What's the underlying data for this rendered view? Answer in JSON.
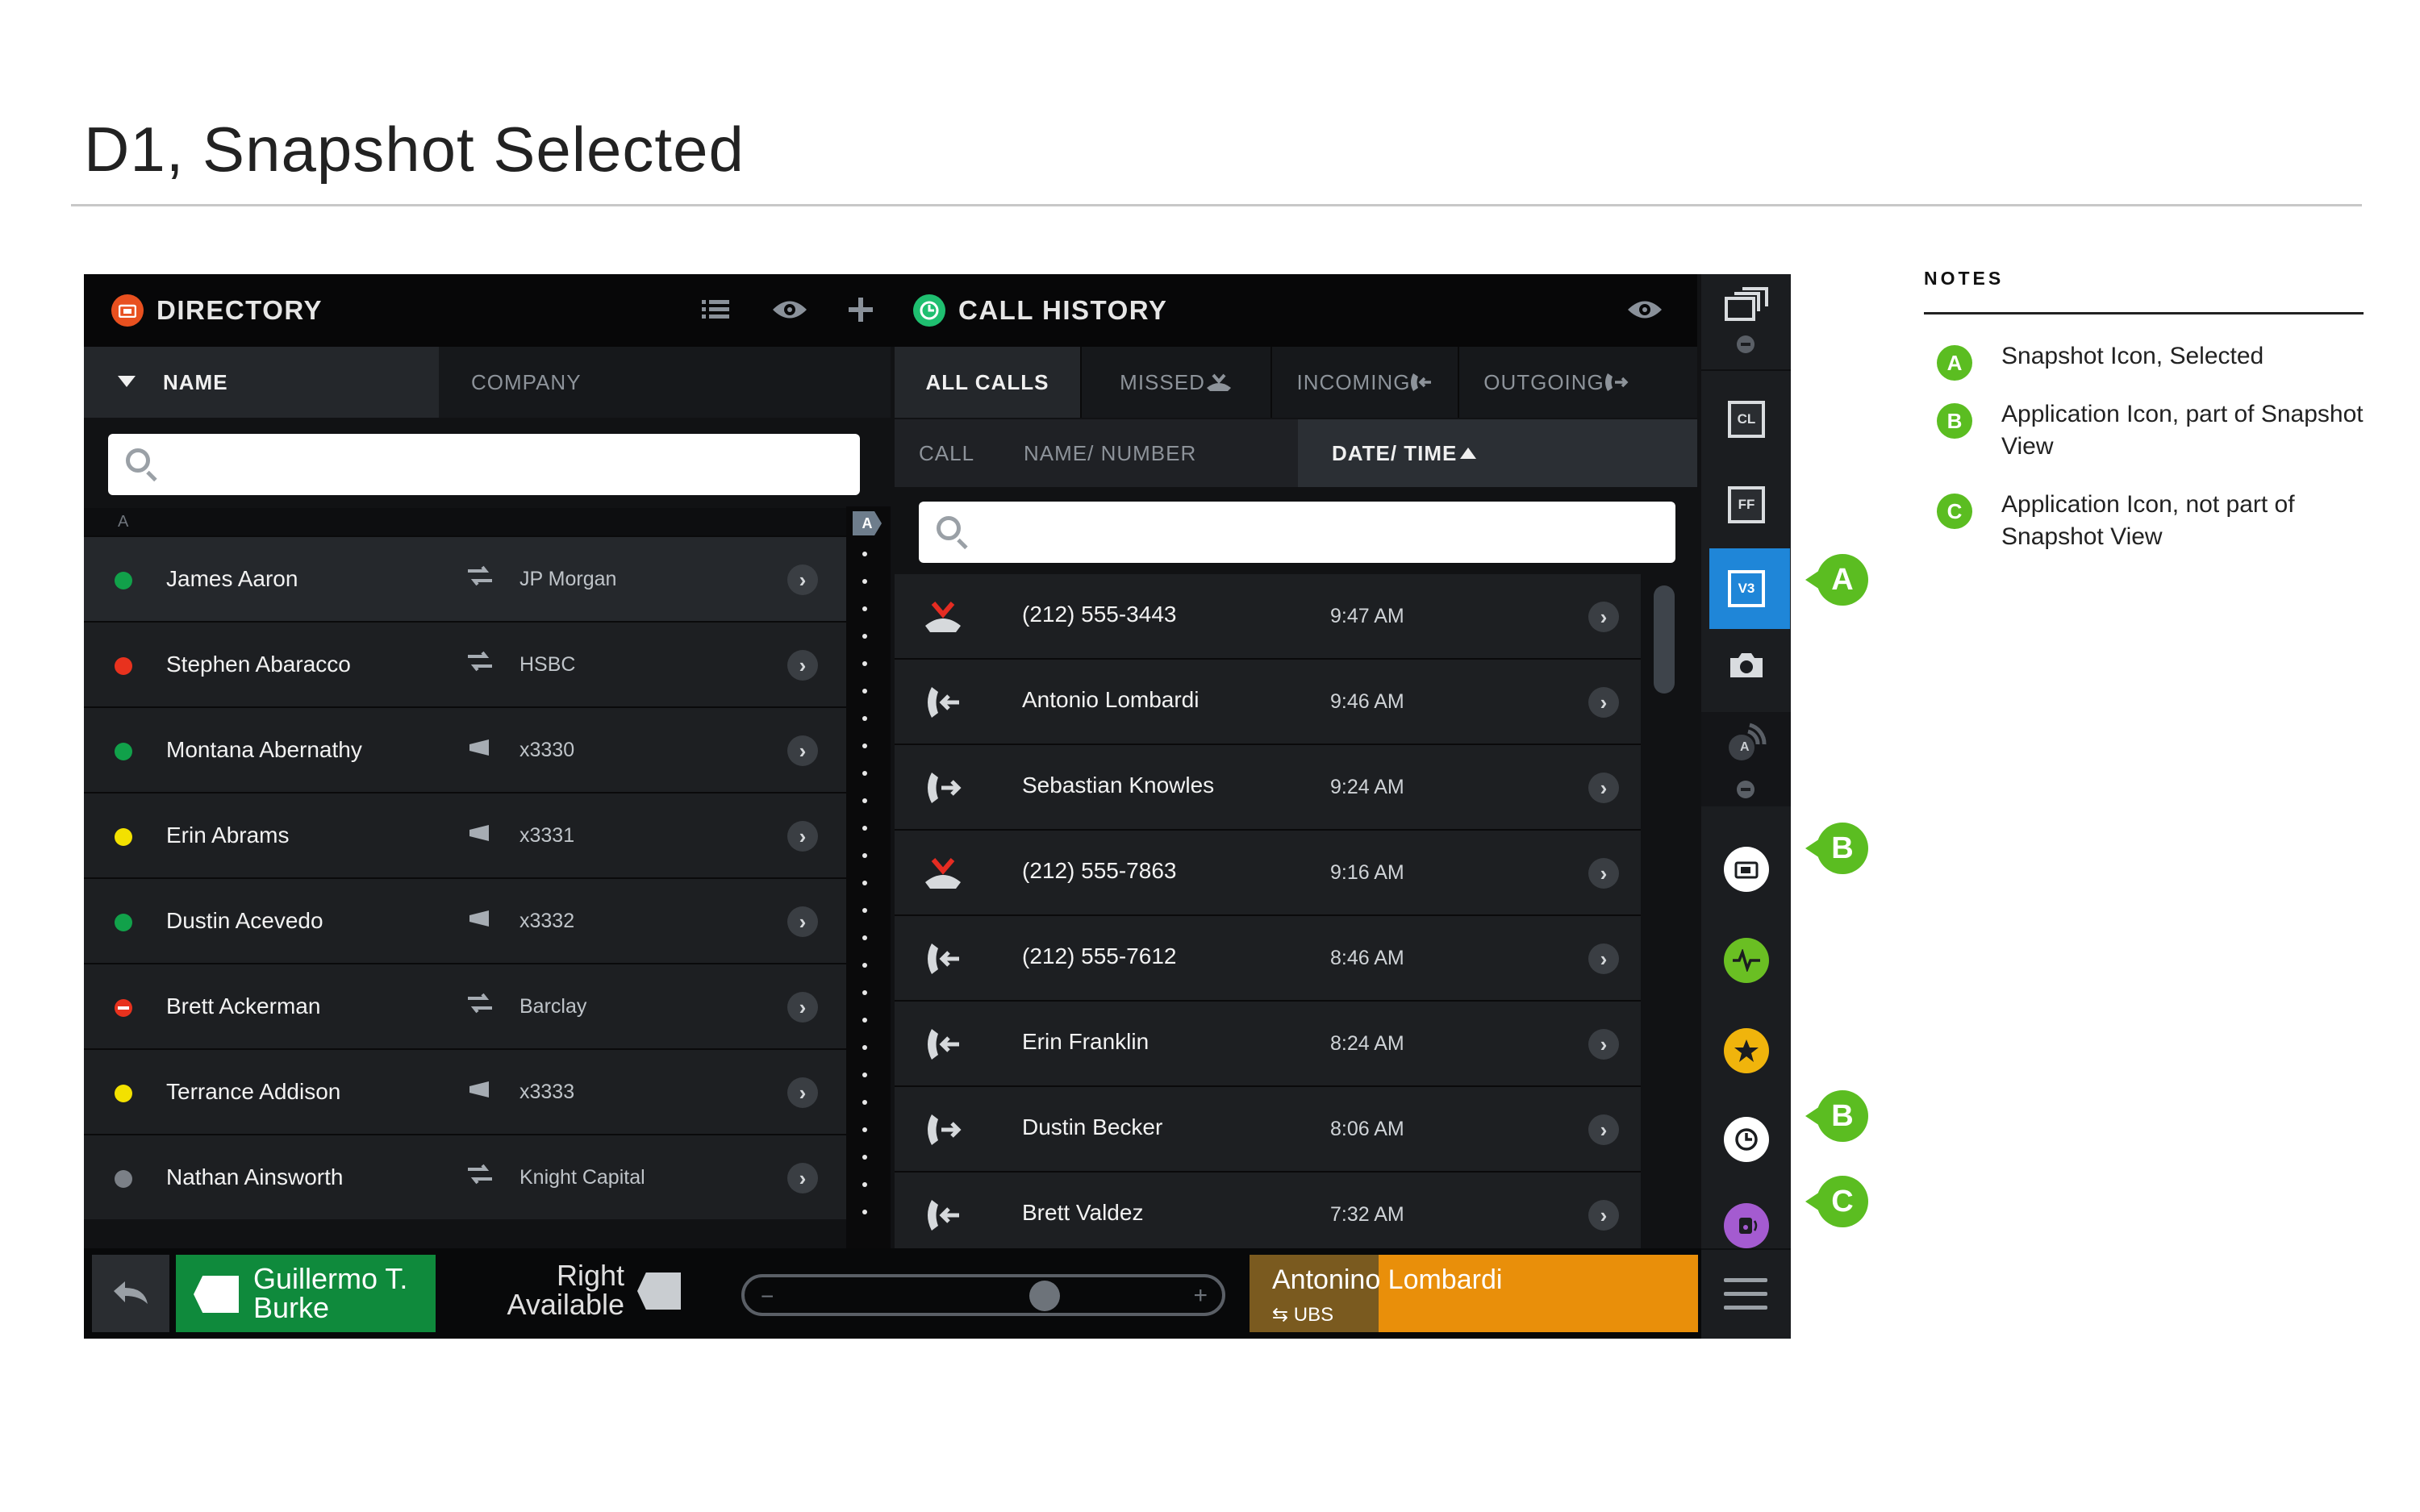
{
  "page": {
    "title": "D1, Snapshot Selected"
  },
  "notes": {
    "heading": "NOTES",
    "items": [
      {
        "badge": "A",
        "text": "Snapshot Icon, Selected"
      },
      {
        "badge": "B",
        "text": "Application Icon, part of Snapshot View"
      },
      {
        "badge": "C",
        "text": "Application Icon, not part of Snapshot View"
      }
    ]
  },
  "markers": {
    "a": "A",
    "b1": "B",
    "b2": "B",
    "c": "C"
  },
  "directory": {
    "title": "DIRECTORY",
    "tabs": {
      "name": "NAME",
      "company": "COMPANY"
    },
    "search": {
      "placeholder": ""
    },
    "section_letter": "A",
    "alpha_tag": "A",
    "rows": [
      {
        "name": "James Aaron",
        "status": "green",
        "type": "trade-icon",
        "company": "JP Morgan"
      },
      {
        "name": "Stephen Abaracco",
        "status": "red",
        "type": "trade-icon",
        "company": "HSBC"
      },
      {
        "name": "Montana Abernathy",
        "status": "green",
        "type": "extension-icon",
        "company": "x3330"
      },
      {
        "name": "Erin Abrams",
        "status": "yellow",
        "type": "extension-icon",
        "company": "x3331"
      },
      {
        "name": "Dustin Acevedo",
        "status": "green",
        "type": "extension-icon",
        "company": "x3332"
      },
      {
        "name": "Brett Ackerman",
        "status": "dnd",
        "type": "trade-icon",
        "company": "Barclay"
      },
      {
        "name": "Terrance Addison",
        "status": "yellow",
        "type": "extension-icon",
        "company": "x3333"
      },
      {
        "name": "Nathan Ainsworth",
        "status": "gray",
        "type": "trade-icon",
        "company": "Knight Capital"
      }
    ]
  },
  "call_history": {
    "title": "CALL HISTORY",
    "tabs": {
      "all": "ALL CALLS",
      "missed": "MISSED",
      "incoming": "INCOMING",
      "outgoing": "OUTGOING"
    },
    "columns": {
      "call": "CALL",
      "name_number": "NAME/ NUMBER",
      "date_time": "DATE/ TIME"
    },
    "search": {
      "placeholder": ""
    },
    "rows": [
      {
        "type": "missed",
        "party": "(212) 555-3443",
        "time": "9:47 AM"
      },
      {
        "type": "incoming",
        "party": "Antonio Lombardi",
        "time": "9:46 AM"
      },
      {
        "type": "outgoing",
        "party": "Sebastian Knowles",
        "time": "9:24 AM"
      },
      {
        "type": "missed",
        "party": "(212) 555-7863",
        "time": "9:16 AM"
      },
      {
        "type": "incoming",
        "party": "(212) 555-7612",
        "time": "8:46 AM"
      },
      {
        "type": "incoming",
        "party": "Erin Franklin",
        "time": "8:24 AM"
      },
      {
        "type": "outgoing",
        "party": "Dustin Becker",
        "time": "8:06 AM"
      },
      {
        "type": "incoming",
        "party": "Brett Valdez",
        "time": "7:32 AM"
      }
    ]
  },
  "rail": {
    "cl": "CL",
    "ff": "FF",
    "v3": "V3",
    "presence_letter": "A"
  },
  "bottom_bar": {
    "active_call_line1": "Guillermo T.",
    "active_call_line2": "Burke",
    "right_line1": "Right",
    "right_line2": "Available",
    "slider_minus": "−",
    "slider_plus": "+",
    "other_call_name": "Antonino Lombardi",
    "other_call_firm": "UBS",
    "slider_level": 0.64
  },
  "colors": {
    "status_green": "#11a14a",
    "status_red": "#e8321e",
    "status_yellow": "#f3e100",
    "status_gray": "#7b8087",
    "missed_red": "#e52c22",
    "annotation_green": "#5bbd21",
    "selected_blue": "#1f86d8",
    "active_call_green": "#0f8a3c",
    "held_call_orange": "#e98f0a"
  }
}
